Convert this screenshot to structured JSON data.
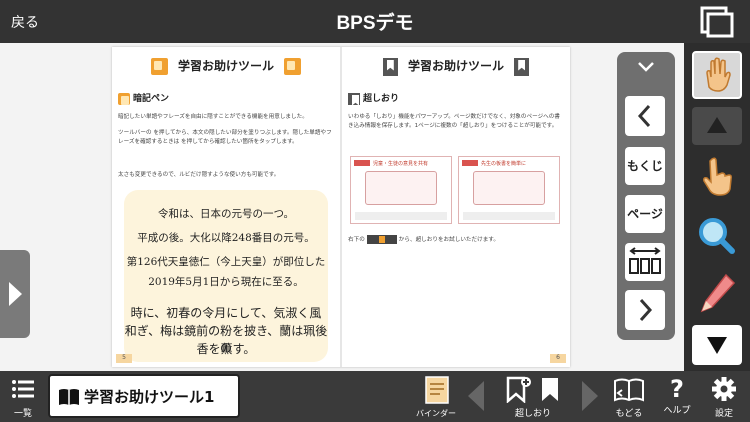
{
  "header": {
    "back_label": "戻る",
    "title": "BPSデモ"
  },
  "book": {
    "left": {
      "title": "学習お助けツール",
      "section": "暗記ペン",
      "p1": "暗記したい単語やフレーズを自由に隠すことができる機能を用意しました。",
      "p2": "ツールバーの   を押してから、本文の隠したい部分を塗りつぶします。隠した単語やフレーズを確認するときは   を押してから確認したい箇所をタップします。",
      "p3": "太さも変更できるので、ルビだけ隠すような使い方も可能です。",
      "poem": {
        "line1": "令和は、日本の元号の一つ。",
        "line2": "平成の後。大化以降248番目の元号。",
        "line3": "第126代天皇徳仁（今上天皇）が即位した",
        "line4": "2019年5月1日から現在に至る。",
        "line5": "時に、初春の令月にして、気淑く風",
        "line6": "和ぎ、梅は鏡前の粉を披き、蘭は珮後の",
        "line7": "香を薫す。"
      },
      "page_number": "5"
    },
    "right": {
      "title": "学習お助けツール",
      "section": "超しおり",
      "p1": "いわゆる「しおり」機能をパワーアップ。ページ数だけでなく、対象のページへの書き込み情報を保存します。1ページに複数の「超しおり」をつけることが可能です。",
      "illus_left_label": "児童・生徒の意見を共有",
      "illus_right_label": "先生の板書を簡単に",
      "p2_before": "右下の",
      "p2_after": "から、超しおりをお試しいただけます。",
      "page_number": "6"
    }
  },
  "nav_panel": {
    "toc_label": "もくじ",
    "page_label": "ページ"
  },
  "bottom_bar": {
    "list_label": "一覧",
    "book_title": "学習お助けツール1",
    "binder_label": "バインダー",
    "bookmark_label": "超しおり",
    "return_label": "もどる",
    "help_label": "ヘルプ",
    "settings_label": "設定"
  },
  "colors": {
    "header_bg": "#333333",
    "accent_orange": "#f0a030",
    "cream_bg": "#fdf4dc"
  }
}
